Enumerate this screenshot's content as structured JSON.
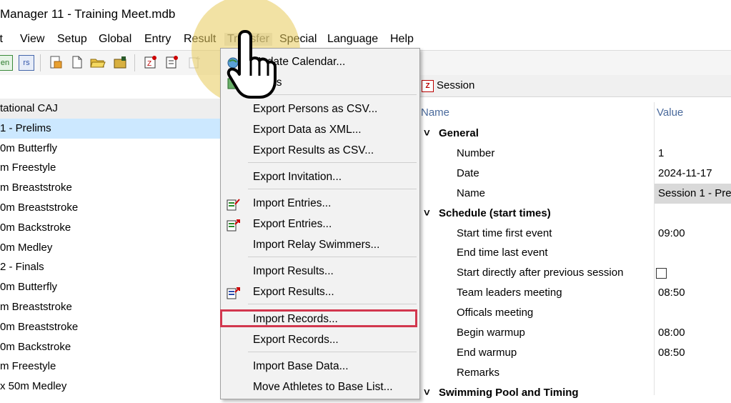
{
  "window": {
    "title": "Manager 11 - Training Meet.mdb"
  },
  "menubar": {
    "items": [
      {
        "label": "it",
        "name": "menu-edit"
      },
      {
        "label": "View",
        "name": "menu-view"
      },
      {
        "label": "Setup",
        "name": "menu-setup"
      },
      {
        "label": "Global",
        "name": "menu-global"
      },
      {
        "label": "Entry",
        "name": "menu-entry"
      },
      {
        "label": "Result",
        "name": "menu-result"
      },
      {
        "label": "Transfer",
        "name": "menu-transfer"
      },
      {
        "label": "Special",
        "name": "menu-special"
      },
      {
        "label": "Language",
        "name": "menu-language"
      },
      {
        "label": "Help",
        "name": "menu-help"
      }
    ]
  },
  "toolbar": {
    "btn_en": "en",
    "btn_rs": "rs"
  },
  "tree": {
    "rows": [
      {
        "label": "tational CAJ",
        "kind": "hdr"
      },
      {
        "label": "1 - Prelims",
        "kind": "sel"
      },
      {
        "label": "0m Butterfly",
        "kind": ""
      },
      {
        "label": "m Freestyle",
        "kind": ""
      },
      {
        "label": "m Breaststroke",
        "kind": ""
      },
      {
        "label": "0m Breaststroke",
        "kind": ""
      },
      {
        "label": "0m Backstroke",
        "kind": ""
      },
      {
        "label": "0m Medley",
        "kind": ""
      },
      {
        "label": "2 - Finals",
        "kind": ""
      },
      {
        "label": "0m Butterfly",
        "kind": ""
      },
      {
        "label": "m Breaststroke",
        "kind": ""
      },
      {
        "label": "0m Breaststroke",
        "kind": ""
      },
      {
        "label": "0m Backstroke",
        "kind": ""
      },
      {
        "label": "m Freestyle",
        "kind": ""
      },
      {
        "label": "x 50m Medley",
        "kind": ""
      }
    ]
  },
  "transfer_menu": {
    "items": [
      {
        "label": "Update Calendar...",
        "icon": "globe-icon",
        "sep_after": false
      },
      {
        "label": "esults",
        "icon": "results-icon",
        "sep_after": true
      },
      {
        "label": "Export Persons as CSV...",
        "icon": "",
        "sep_after": false
      },
      {
        "label": "Export Data as XML...",
        "icon": "",
        "sep_after": false
      },
      {
        "label": "Export Results as CSV...",
        "icon": "",
        "sep_after": true
      },
      {
        "label": "Export Invitation...",
        "icon": "",
        "sep_after": true
      },
      {
        "label": "Import Entries...",
        "icon": "import-entries-icon",
        "sep_after": false
      },
      {
        "label": "Export Entries...",
        "icon": "export-entries-icon",
        "sep_after": false
      },
      {
        "label": "Import Relay Swimmers...",
        "icon": "",
        "sep_after": true
      },
      {
        "label": "Import Results...",
        "icon": "",
        "sep_after": false
      },
      {
        "label": "Export Results...",
        "icon": "export-results-icon",
        "sep_after": true
      },
      {
        "label": "Import Records...",
        "icon": "",
        "sep_after": false
      },
      {
        "label": "Export Records...",
        "icon": "",
        "sep_after": true
      },
      {
        "label": "Import Base Data...",
        "icon": "",
        "sep_after": false
      },
      {
        "label": "Move Athletes to Base List...",
        "icon": "",
        "sep_after": false
      }
    ]
  },
  "session_panel": {
    "title": "Session",
    "col_name": "Name",
    "col_value": "Value",
    "rows": [
      {
        "type": "group",
        "label": "General"
      },
      {
        "type": "prop",
        "label": "Number",
        "value": "1"
      },
      {
        "type": "prop",
        "label": "Date",
        "value": "2024-11-17"
      },
      {
        "type": "prop",
        "label": "Name",
        "value": "Session 1 - Pre",
        "highlight": true
      },
      {
        "type": "group",
        "label": "Schedule (start times)"
      },
      {
        "type": "prop",
        "label": "Start time first event",
        "value": "09:00"
      },
      {
        "type": "prop",
        "label": "End time last event",
        "value": ""
      },
      {
        "type": "prop",
        "label": "Start directly after previous session",
        "value": "",
        "checkbox": true
      },
      {
        "type": "prop",
        "label": "Team leaders meeting",
        "value": "08:50"
      },
      {
        "type": "prop",
        "label": "Officals meeting",
        "value": ""
      },
      {
        "type": "prop",
        "label": "Begin warmup",
        "value": "08:00"
      },
      {
        "type": "prop",
        "label": "End warmup",
        "value": "08:50"
      },
      {
        "type": "prop",
        "label": "Remarks",
        "value": ""
      },
      {
        "type": "group",
        "label": "Swimming Pool and Timing"
      }
    ]
  },
  "colors": {
    "highlight_border": "#d2374e",
    "selection": "#cce8ff",
    "spotlight": "#e8ca5a"
  }
}
